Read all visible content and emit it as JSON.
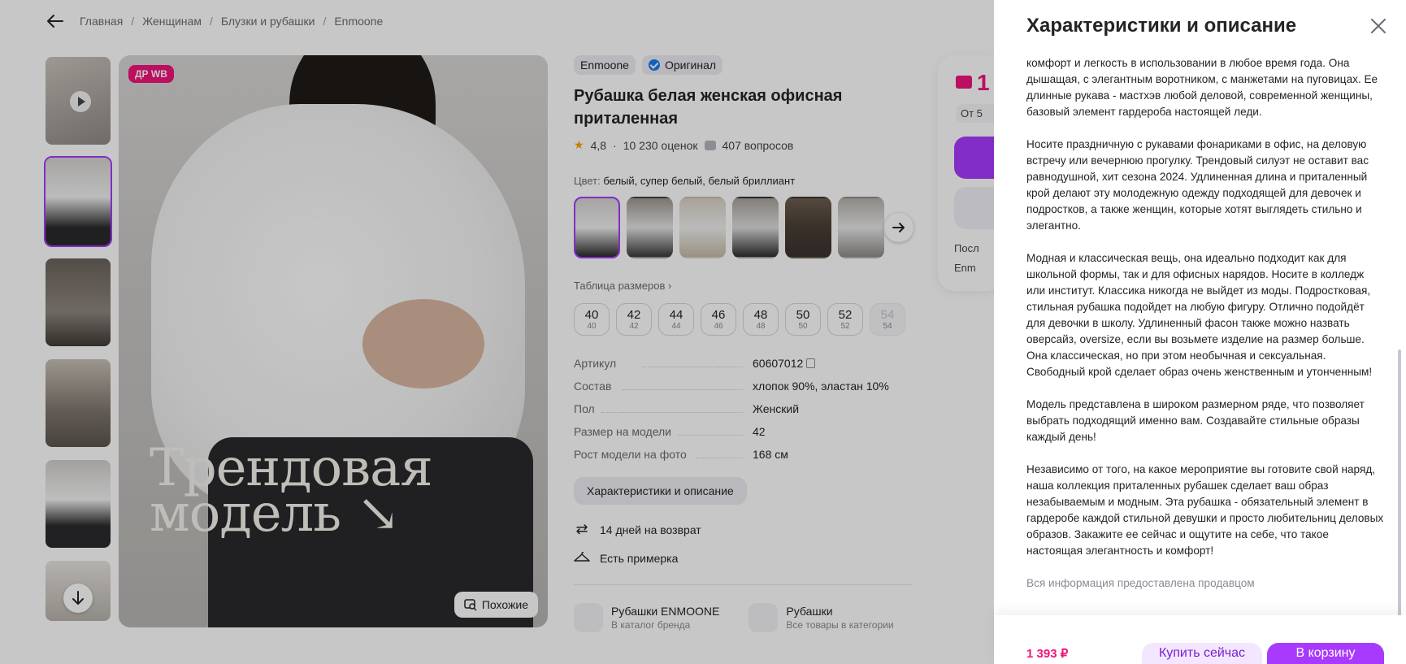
{
  "breadcrumbs": [
    "Главная",
    "Женщинам",
    "Блузки и рубашки",
    "Enmoone"
  ],
  "gallery": {
    "badge": "ДР WB",
    "overlay_title_line1": "Трендовая",
    "overlay_title_line2": "модель ↘",
    "similar_label": "Похожие",
    "thumb_colors": [
      "#b9b2ac",
      "#8a8682",
      "#6e6963",
      "#7a766f",
      "#5f5a55",
      "#8d8780"
    ]
  },
  "product": {
    "brand": "Enmoone",
    "original_label": "Оригинал",
    "title": "Рубашка белая женская офисная приталенная",
    "rating": "4,8",
    "reviews": "10 230 оценок",
    "questions": "407 вопросов",
    "color_label": "Цвет:",
    "color_value": "белый, супер белый, белый бриллиант",
    "size_table_label": "Таблица размеров ›",
    "sizes": [
      {
        "main": "40",
        "sub": "40"
      },
      {
        "main": "42",
        "sub": "42"
      },
      {
        "main": "44",
        "sub": "44"
      },
      {
        "main": "46",
        "sub": "46"
      },
      {
        "main": "48",
        "sub": "48"
      },
      {
        "main": "50",
        "sub": "50"
      },
      {
        "main": "52",
        "sub": "52"
      },
      {
        "main": "54",
        "sub": "54"
      }
    ],
    "specs": [
      {
        "name": "Артикул",
        "value": "60607012"
      },
      {
        "name": "Состав",
        "value": "хлопок 90%, эластан 10%"
      },
      {
        "name": "Пол",
        "value": "Женский"
      },
      {
        "name": "Размер на модели",
        "value": "42"
      },
      {
        "name": "Рост модели на фото",
        "value": "168 см"
      }
    ],
    "characteristics_button": "Характеристики и описание",
    "return_text": "14 дней на возврат",
    "fitting_text": "Есть примерка",
    "brand_link_title": "Рубашки ENMOONE",
    "brand_link_sub": "В каталог бренда",
    "category_link_title": "Рубашки",
    "category_link_sub": "Все товары в категории"
  },
  "buy_card": {
    "price_fragment": "1",
    "ot_fragment": "От 5",
    "line1_fragment": "Посл",
    "line2_fragment": "Enm"
  },
  "panel": {
    "title": "Характеристики и описание",
    "paragraphs": [
      "комфорт и легкость в использовании в любое время года. Она дышащая, с элегантным воротником, с манжетами на пуговицах. Ее длинные рукава - мастхэв любой деловой, современной женщины, базовый элемент гардероба настоящей леди.",
      "Носите праздничную с рукавами фонариками в офис, на деловую встречу или вечернюю прогулку. Трендовый силуэт не оставит вас равнодушной, хит сезона 2024. Удлиненная длина и приталенный крой делают эту молодежную одежду подходящей для девочек и подростков, а также женщин, которые хотят выглядеть стильно и элегантно.",
      "Модная и классическая вещь, она идеально подходит как для школьной формы, так и для офисных нарядов. Носите в колледж или институт. Классика никогда не выйдет из моды. Подростковая, стильная рубашка подойдет на любую фигуру. Отлично подойдёт для девочки в школу. Удлиненный фасон также можно назвать оверсайз, oversize, если вы возьмете изделие на размер больше. Она классическая, но при этом необычная и сексуальная. Свободный крой сделает образ очень женственным и утонченным!",
      "Модель представлена в широком размерном ряде, что позволяет выбрать подходящий именно вам. Создавайте стильные образы каждый день!",
      "Независимо от того, на какое мероприятие вы готовите свой наряд, наша коллекция приталенных рубашек сделает ваш образ незабываемым и модным. Эта рубашка - обязательный элемент в гардеробе каждой стильной девушки и просто любительниц деловых образов. Закажите ее сейчас и ощутите на себе, что такое настоящая элегантность и комфорт!"
    ],
    "note": "Вся информация предоставлена продавцом",
    "footer_price": "1 393 ₽",
    "buy_now_label": "Купить сейчас",
    "cart_label": "В корзину"
  },
  "colors": {
    "accent": "#a73afd",
    "price_pink": "#f0147a",
    "overlay": "rgba(0,0,0,0.22)"
  }
}
